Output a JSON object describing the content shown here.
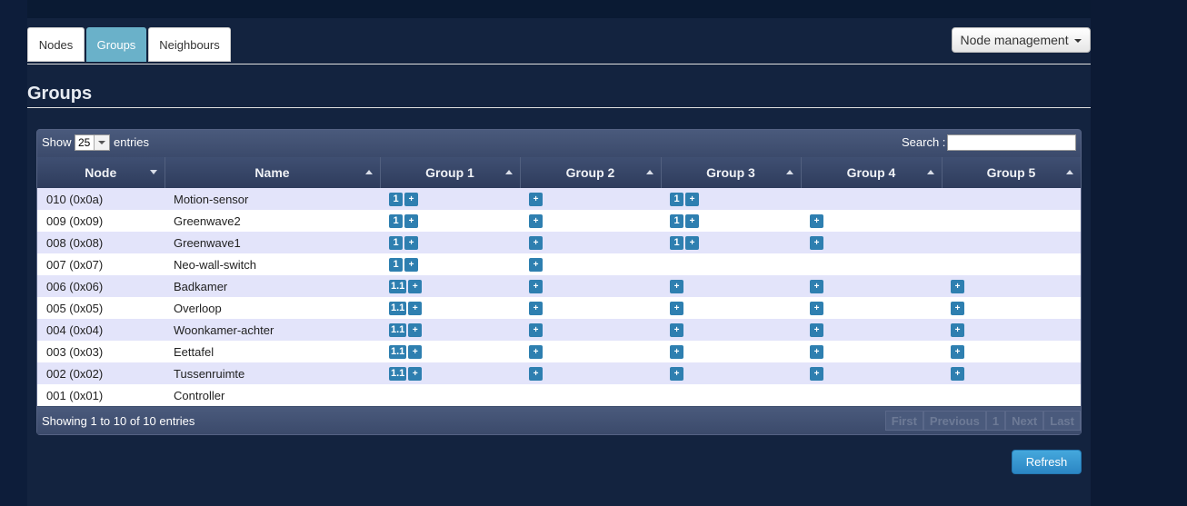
{
  "tabs": [
    {
      "label": "Nodes",
      "active": false
    },
    {
      "label": "Groups",
      "active": true
    },
    {
      "label": "Neighbours",
      "active": false
    }
  ],
  "node_management_label": "Node management",
  "page_title": "Groups",
  "table": {
    "show_label": "Show",
    "page_length": "25",
    "entries_label": "entries",
    "search_label": "Search :",
    "search_value": "",
    "columns": [
      "Node",
      "Name",
      "Group 1",
      "Group 2",
      "Group 3",
      "Group 4",
      "Group 5"
    ],
    "rows": [
      {
        "node": "010 (0x0a)",
        "name": "Motion-sensor",
        "groups": [
          [
            "1",
            "+"
          ],
          [
            "+"
          ],
          [
            "1",
            "+"
          ],
          [],
          []
        ]
      },
      {
        "node": "009 (0x09)",
        "name": "Greenwave2",
        "groups": [
          [
            "1",
            "+"
          ],
          [
            "+"
          ],
          [
            "1",
            "+"
          ],
          [
            "+"
          ],
          []
        ]
      },
      {
        "node": "008 (0x08)",
        "name": "Greenwave1",
        "groups": [
          [
            "1",
            "+"
          ],
          [
            "+"
          ],
          [
            "1",
            "+"
          ],
          [
            "+"
          ],
          []
        ]
      },
      {
        "node": "007 (0x07)",
        "name": "Neo-wall-switch",
        "groups": [
          [
            "1",
            "+"
          ],
          [
            "+"
          ],
          [],
          [],
          []
        ]
      },
      {
        "node": "006 (0x06)",
        "name": "Badkamer",
        "groups": [
          [
            "1.1",
            "+"
          ],
          [
            "+"
          ],
          [
            "+"
          ],
          [
            "+"
          ],
          [
            "+"
          ]
        ]
      },
      {
        "node": "005 (0x05)",
        "name": "Overloop",
        "groups": [
          [
            "1.1",
            "+"
          ],
          [
            "+"
          ],
          [
            "+"
          ],
          [
            "+"
          ],
          [
            "+"
          ]
        ]
      },
      {
        "node": "004 (0x04)",
        "name": "Woonkamer-achter",
        "groups": [
          [
            "1.1",
            "+"
          ],
          [
            "+"
          ],
          [
            "+"
          ],
          [
            "+"
          ],
          [
            "+"
          ]
        ]
      },
      {
        "node": "003 (0x03)",
        "name": "Eettafel",
        "groups": [
          [
            "1.1",
            "+"
          ],
          [
            "+"
          ],
          [
            "+"
          ],
          [
            "+"
          ],
          [
            "+"
          ]
        ]
      },
      {
        "node": "002 (0x02)",
        "name": "Tussenruimte",
        "groups": [
          [
            "1.1",
            "+"
          ],
          [
            "+"
          ],
          [
            "+"
          ],
          [
            "+"
          ],
          [
            "+"
          ]
        ]
      },
      {
        "node": "001 (0x01)",
        "name": "Controller",
        "groups": [
          [],
          [],
          [],
          [],
          []
        ]
      }
    ],
    "info": "Showing 1 to 10 of 10 entries",
    "pager": [
      "First",
      "Previous",
      "1",
      "Next",
      "Last"
    ]
  },
  "refresh_label": "Refresh",
  "colors": {
    "active_tab": "#6ab1c9",
    "group_badge": "#2e7fb0",
    "odd_row": "#e3e4fa"
  }
}
